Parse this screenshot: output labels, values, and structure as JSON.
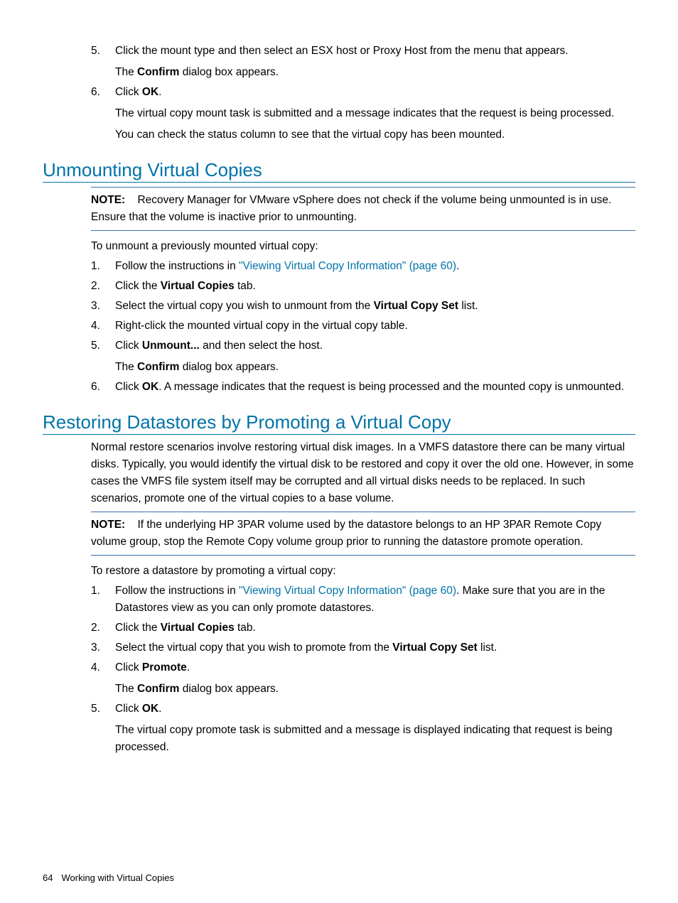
{
  "topList": {
    "item5": {
      "num": "5.",
      "text_before": "Click the mount type and then select an ESX host or Proxy Host from the menu that appears.",
      "para2_before": "The ",
      "para2_bold": "Confirm",
      "para2_after": " dialog box appears."
    },
    "item6": {
      "num": "6.",
      "text_before": "Click ",
      "bold1": "OK",
      "text_after": ".",
      "para2": "The virtual copy mount task is submitted and a message indicates that the request is being processed.",
      "para3": "You can check the status column to see that the virtual copy has been mounted."
    }
  },
  "section1": {
    "heading": "Unmounting Virtual Copies",
    "note_label": "NOTE:",
    "note_text": "Recovery Manager for VMware vSphere does not check if the volume being unmounted is in use. Ensure that the volume is inactive prior to unmounting.",
    "intro": "To unmount a previously mounted virtual copy:",
    "items": {
      "i1": {
        "num": "1.",
        "before": "Follow the instructions in ",
        "link": "\"Viewing Virtual Copy Information\" (page 60)",
        "after": "."
      },
      "i2": {
        "num": "2.",
        "before": "Click the ",
        "bold": "Virtual Copies",
        "after": " tab."
      },
      "i3": {
        "num": "3.",
        "before": "Select the virtual copy you wish to unmount from the ",
        "bold": "Virtual Copy Set",
        "after": " list."
      },
      "i4": {
        "num": "4.",
        "text": "Right-click the mounted virtual copy in the virtual copy table."
      },
      "i5": {
        "num": "5.",
        "before": "Click ",
        "bold": "Unmount...",
        "after": " and then select the host.",
        "para2_before": "The ",
        "para2_bold": "Confirm",
        "para2_after": " dialog box appears."
      },
      "i6": {
        "num": "6.",
        "before": "Click ",
        "bold": "OK",
        "after": ". A message indicates that the request is being processed and the mounted copy is unmounted."
      }
    }
  },
  "section2": {
    "heading": "Restoring Datastores by Promoting a Virtual Copy",
    "intro": "Normal restore scenarios involve restoring virtual disk images. In a VMFS datastore there can be many virtual disks. Typically, you would identify the virtual disk to be restored and copy it over the old one. However, in some cases the VMFS file system itself may be corrupted and all virtual disks needs to be replaced. In such scenarios, promote one of the virtual copies to a base volume.",
    "note_label": "NOTE:",
    "note_text": "If the underlying HP 3PAR volume used by the datastore belongs to an HP 3PAR Remote Copy volume group, stop the Remote Copy volume group prior to running the datastore promote operation.",
    "intro2": "To restore a datastore by promoting a virtual copy:",
    "items": {
      "i1": {
        "num": "1.",
        "before": "Follow the instructions in ",
        "link": "\"Viewing Virtual Copy Information\" (page 60)",
        "after": ". Make sure that you are in the Datastores view as you can only promote datastores."
      },
      "i2": {
        "num": "2.",
        "before": "Click the ",
        "bold": "Virtual Copies",
        "after": " tab."
      },
      "i3": {
        "num": "3.",
        "before": "Select the virtual copy that you wish to promote from the ",
        "bold": "Virtual Copy Set",
        "after": " list."
      },
      "i4": {
        "num": "4.",
        "before": "Click ",
        "bold": "Promote",
        "after": ".",
        "para2_before": "The ",
        "para2_bold": "Confirm",
        "para2_after": " dialog box appears."
      },
      "i5": {
        "num": "5.",
        "before": "Click ",
        "bold": "OK",
        "after": ".",
        "para2": "The virtual copy promote task is submitted and a message is displayed indicating that request is being processed."
      }
    }
  },
  "footer": {
    "page": "64",
    "chapter": "Working with Virtual Copies"
  }
}
